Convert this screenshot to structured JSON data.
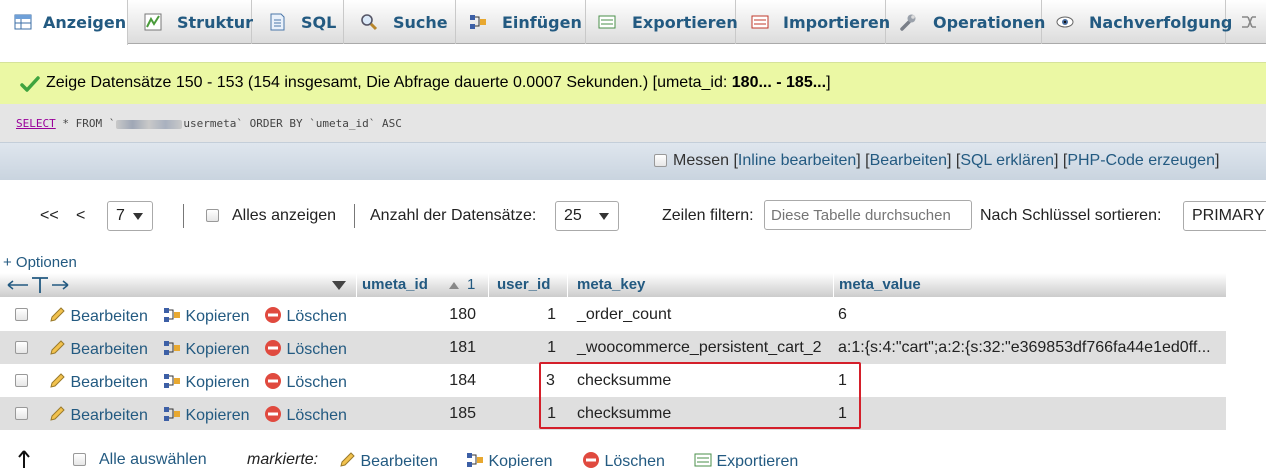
{
  "tabs": [
    {
      "label": "Anzeigen",
      "icon": "table-browse-icon",
      "active": true
    },
    {
      "label": "Struktur",
      "icon": "structure-icon"
    },
    {
      "label": "SQL",
      "icon": "sql-icon"
    },
    {
      "label": "Suche",
      "icon": "search-icon"
    },
    {
      "label": "Einfügen",
      "icon": "insert-icon"
    },
    {
      "label": "Exportieren",
      "icon": "export-icon"
    },
    {
      "label": "Importieren",
      "icon": "import-icon"
    },
    {
      "label": "Operationen",
      "icon": "wrench-icon"
    },
    {
      "label": "Nachverfolgung",
      "icon": "eye-icon"
    },
    {
      "label": "",
      "icon": "triggers-icon"
    }
  ],
  "success": {
    "text": "Zeige Datensätze 150 - 153 (154 insgesamt, Die Abfrage dauerte 0.0007 Sekunden.) [umeta_id: ",
    "range_bold": "180... - 185...",
    "close": "]"
  },
  "sql": {
    "select": "SELECT",
    "rest1": " * FROM `",
    "table_suffix": "usermeta` ORDER BY `umeta_id` ASC"
  },
  "actions": {
    "measure": "Messen [",
    "inline_edit": "Inline bearbeiten",
    "sep1": "] [",
    "edit": "Bearbeiten",
    "sep2": "] [",
    "sql_explain": "SQL erklären",
    "sep3": "] [",
    "php_code": "PHP-Code erzeugen",
    "end": "]"
  },
  "nav": {
    "first": "<<",
    "prev": "<",
    "page": "7",
    "show_all": "Alles anzeigen",
    "rows_label": "Anzahl der Datensätze:",
    "rows_value": "25",
    "filter_label": "Zeilen filtern:",
    "filter_placeholder": "Diese Tabelle durchsuchen",
    "sort_label": "Nach Schlüssel sortieren:",
    "sort_value": "PRIMARY"
  },
  "options_link": "+ Optionen",
  "table": {
    "columns": {
      "umeta_id": "umeta_id",
      "sort_order": "1",
      "user_id": "user_id",
      "meta_key": "meta_key",
      "meta_value": "meta_value"
    },
    "row_actions": {
      "edit": "Bearbeiten",
      "copy": "Kopieren",
      "delete": "Löschen"
    },
    "rows": [
      {
        "umeta_id": "180",
        "user_id": "1",
        "meta_key": "_order_count",
        "meta_value": "6"
      },
      {
        "umeta_id": "181",
        "user_id": "1",
        "meta_key": "_woocommerce_persistent_cart_2",
        "meta_value": "a:1:{s:4:\"cart\";a:2:{s:32:\"e369853df766fa44e1ed0ff..."
      },
      {
        "umeta_id": "184",
        "user_id": "3",
        "meta_key": "checksumme",
        "meta_value": "1"
      },
      {
        "umeta_id": "185",
        "user_id": "1",
        "meta_key": "checksumme",
        "meta_value": "1"
      }
    ]
  },
  "bottom": {
    "select_all": "Alle auswählen",
    "marked": "markierte:",
    "edit": "Bearbeiten",
    "copy": "Kopieren",
    "delete": "Löschen",
    "export": "Exportieren"
  },
  "colors": {
    "link": "#235a81",
    "success_bg": "#ebf8a4",
    "highlight": "#d41f2a"
  }
}
